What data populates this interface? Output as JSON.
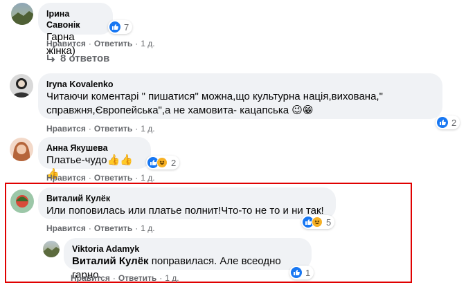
{
  "actions": {
    "like": "Нравится",
    "reply": "Ответить",
    "sep": "·"
  },
  "comments": [
    {
      "author": "Ірина Савонік",
      "text": "Гарна жінка)",
      "age": "1 д.",
      "reactions": {
        "count": "7",
        "types": [
          "like"
        ]
      }
    },
    {
      "replies_label": "8 ответов"
    },
    {
      "author": "Iryna Kovalenko",
      "text_line1": "Читаючи коментарі \" пишатися\" можна,що культурна нація,вихована,\"",
      "text_line2": "справжня,Європейська\",а не хамовита- кацапська 😉😁",
      "age": "1 д.",
      "reactions": {
        "count": "2",
        "types": [
          "like"
        ]
      }
    },
    {
      "author": "Анна Якушева",
      "text": "Платье-чудо👍👍👍",
      "age": "1 д.",
      "reactions": {
        "count": "2",
        "types": [
          "like",
          "haha"
        ]
      }
    },
    {
      "author": "Виталий Кулёк",
      "text": "Или поповилась или платье полнит!Что-то не то и ни так!",
      "age": "1 д.",
      "reactions": {
        "count": "5",
        "types": [
          "like",
          "haha"
        ]
      }
    },
    {
      "author": "Viktoria Adamyk",
      "mention": "Виталий Кулёк",
      "text": " поправилася. Але всеодно гарно.",
      "age": "1 д.",
      "reactions": {
        "count": "1",
        "types": [
          "like"
        ]
      }
    }
  ],
  "colors": {
    "accent": "#1877f2",
    "highlight": "#e00000",
    "bubble": "#f0f2f5",
    "meta": "#65676b"
  }
}
